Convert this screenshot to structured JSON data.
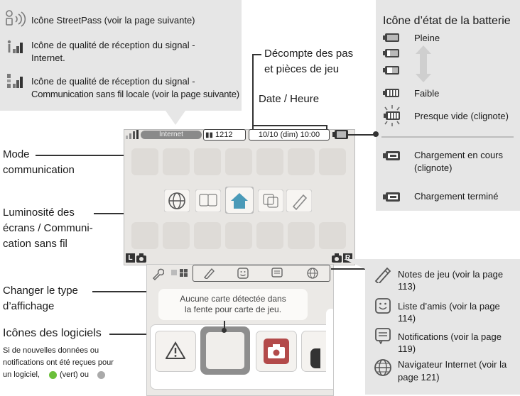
{
  "left_panel": {
    "streetpass": "Icône StreetPass (voir la page suivante)",
    "internet_line1": "Icône de qualité de réception du  signal -",
    "internet_line2": "Internet.",
    "local_line1": "Icône de qualité de réception du signal -",
    "local_line2": "Communication sans fil locale (voir la page suivante)"
  },
  "callouts": {
    "steps_line1": "Décompte des pas",
    "steps_line2": "et pièces de jeu",
    "datetime": "Date / Heure",
    "mode_line1": "Mode",
    "mode_line2": "communication",
    "lum_line1": "Luminosité des",
    "lum_line2": "écrans / Communi-",
    "lum_line3": "cation sans fil",
    "view_line1": "Changer le type",
    "view_line2": "d’affichage",
    "software_title": "Icônes des logiciels",
    "software_desc1": "Si de nouvelles données ou",
    "software_desc2": "notifications ont été reçues pour",
    "software_desc3a": "un logiciel,",
    "software_desc3b": "(vert) ou"
  },
  "battery_panel": {
    "title": "Icône d’état de la batterie",
    "full": "Pleine",
    "low": "Faible",
    "empty": "Presque vide (clignote)",
    "charging_line1": "Chargement en cours",
    "charging_line2": "(clignote)",
    "charged": "Chargement terminé"
  },
  "apps_panel": {
    "notes": "Notes de jeu (voir la page 113)",
    "friends": "Liste d’amis (voir la page 114)",
    "notifications": "Notifications (voir la page 119)",
    "browser_line1": "Navigateur Internet (voir la",
    "browser_line2": "page 121)"
  },
  "top_screen": {
    "mode_tag": "Internet",
    "steps": "1212",
    "datetime": "10/10 (dim)  10:00",
    "l_button": "L",
    "r_button": "R"
  },
  "bottom_screen": {
    "message_line1": "Aucune carte détectée dans",
    "message_line2": "la fente pour carte de jeu."
  },
  "colors": {
    "panel": "#e6e6e6",
    "green_dot": "#6abf3a",
    "screen": "#e8e6e3"
  }
}
